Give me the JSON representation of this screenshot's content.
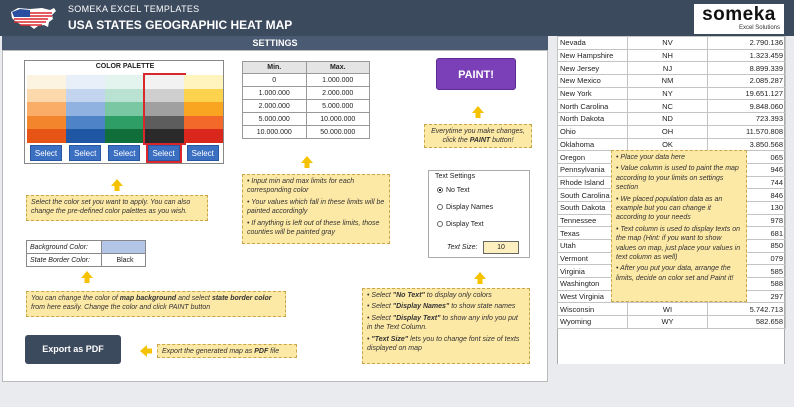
{
  "header": {
    "brand": "SOMEKA EXCEL TEMPLATES",
    "title": "USA STATES GEOGRAPHIC HEAT MAP",
    "logo": "someka",
    "logo_sub": "Excel Solutions"
  },
  "settings": {
    "title": "SETTINGS",
    "palette_title": "COLOR PALETTE",
    "select_label": "Select",
    "selected_index": 3,
    "palettes": [
      [
        "#fdf3e1",
        "#fbd9ad",
        "#f9ad67",
        "#f3862c",
        "#e65515"
      ],
      [
        "#e8eff9",
        "#c2d4ee",
        "#8fb2e0",
        "#4f83c8",
        "#1f57a4"
      ],
      [
        "#e3f4ee",
        "#b9e2d2",
        "#79c7a3",
        "#2f9e66",
        "#0f6e3a"
      ],
      [
        "#f2f2f2",
        "#cfcfcf",
        "#a0a0a0",
        "#5d5d5d",
        "#2a2a2a"
      ],
      [
        "#fff4bd",
        "#fdd24d",
        "#f9a521",
        "#f2692a",
        "#d9271d"
      ]
    ],
    "palette_note": "Select the color set you want to apply. You can also change the pre-defined color palettes as you wish.",
    "limits": {
      "header_min": "Min.",
      "header_max": "Max.",
      "rows": [
        [
          "0",
          "1.000.000"
        ],
        [
          "1.000.000",
          "2.000.000"
        ],
        [
          "2.000.000",
          "5.000.000"
        ],
        [
          "5.000.000",
          "10.000.000"
        ],
        [
          "10.000.000",
          "50.000.000"
        ]
      ]
    },
    "limits_note": [
      "• Input min and max limits for each corresponding color",
      "• Your values which fall in these limits will be painted accordingly",
      "• If anything is left out of these limits, those counties will be painted gray"
    ],
    "paint_label": "PAINT!",
    "paint_note_1": "Everytime you make changes,",
    "paint_note_2": "click the ",
    "paint_note_bold": "PAINT",
    "paint_note_3": " button!",
    "bg_label": "Background Color:",
    "border_label": "State Border Color:",
    "border_value": "Black",
    "bg_color": "#b4c6e7",
    "bg_note_a": "You can change the color of ",
    "bg_note_b": "map background",
    "bg_note_c": " and select ",
    "bg_note_d": "state border color",
    "bg_note_e": " from here easily. Change the color and click PAINT button",
    "text_settings_title": "Text Settings",
    "radio_options": [
      "No Text",
      "Display Names",
      "Display Text"
    ],
    "radio_selected": 0,
    "text_size_label": "Text Size:",
    "text_size_value": "10",
    "text_note": [
      {
        "a": "• Select ",
        "b": "\"No Text\"",
        "c": " to display only colors"
      },
      {
        "a": "• Select ",
        "b": "\"Display Names\"",
        "c": " to show state names"
      },
      {
        "a": "• Select ",
        "b": "\"Display Text\"",
        "c": " to show any info you put in the Text Column."
      },
      {
        "a": "• ",
        "b": "\"Text Size\"",
        "c": " lets you to change font size of texts displayed on map"
      }
    ],
    "export_label": "Export as PDF",
    "export_note_a": "Export the generated map as ",
    "export_note_b": "PDF",
    "export_note_c": " file"
  },
  "data_table": {
    "rows": [
      [
        "Nevada",
        "NV",
        "2.790.136"
      ],
      [
        "New Hampshire",
        "NH",
        "1.323.459"
      ],
      [
        "New Jersey",
        "NJ",
        "8.899.339"
      ],
      [
        "New Mexico",
        "NM",
        "2.085.287"
      ],
      [
        "New York",
        "NY",
        "19.651.127"
      ],
      [
        "North Carolina",
        "NC",
        "9.848.060"
      ],
      [
        "North Dakota",
        "ND",
        "723.393"
      ],
      [
        "Ohio",
        "OH",
        "11.570.808"
      ],
      [
        "Oklahoma",
        "OK",
        "3.850.568"
      ],
      [
        "Oregon",
        "",
        "065"
      ],
      [
        "Pennsylvania",
        "",
        "946"
      ],
      [
        "Rhode Island",
        "",
        "744"
      ],
      [
        "South Carolina",
        "",
        "846"
      ],
      [
        "South Dakota",
        "",
        "130"
      ],
      [
        "Tennessee",
        "",
        "978"
      ],
      [
        "Texas",
        "",
        "681"
      ],
      [
        "Utah",
        "",
        "850"
      ],
      [
        "Vermont",
        "",
        "079"
      ],
      [
        "Virginia",
        "",
        "585"
      ],
      [
        "Washington",
        "",
        "588"
      ],
      [
        "West Virginia",
        "",
        "297"
      ],
      [
        "Wisconsin",
        "WI",
        "5.742.713"
      ],
      [
        "Wyoming",
        "WY",
        "582.658"
      ]
    ],
    "note": [
      "• Place your data here",
      "• Value column is used to paint the map according to your limits on settings section",
      "• We placed population data as an example but you can change it according to your needs",
      "• Text column is used to display texts on the map (Hint: if you want to show values on map, just place your values in text column as well)",
      "• After you put your data, arrange the limits, decide on color set and Paint it!"
    ]
  }
}
